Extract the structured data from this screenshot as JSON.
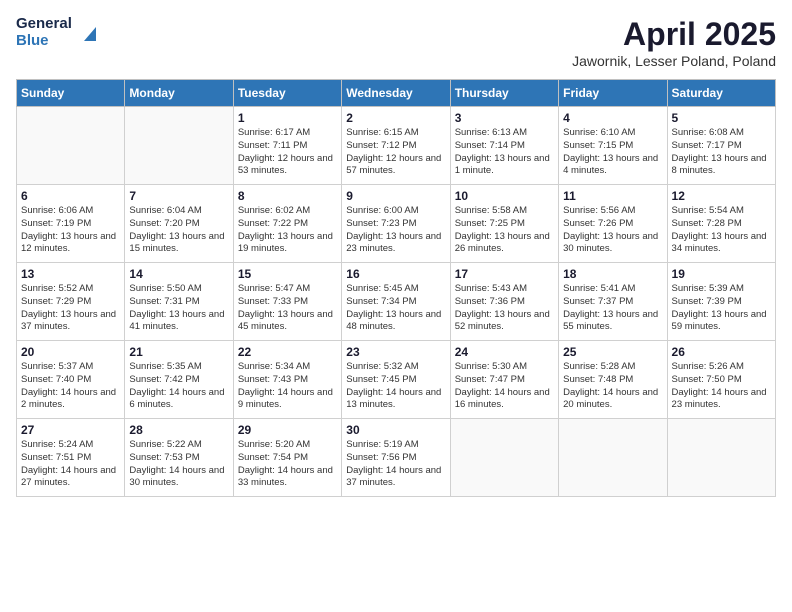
{
  "header": {
    "logo_general": "General",
    "logo_blue": "Blue",
    "month_title": "April 2025",
    "location": "Jawornik, Lesser Poland, Poland"
  },
  "weekdays": [
    "Sunday",
    "Monday",
    "Tuesday",
    "Wednesday",
    "Thursday",
    "Friday",
    "Saturday"
  ],
  "days": [
    {
      "num": "",
      "sunrise": "",
      "sunset": "",
      "daylight": ""
    },
    {
      "num": "",
      "sunrise": "",
      "sunset": "",
      "daylight": ""
    },
    {
      "num": "1",
      "sunrise": "Sunrise: 6:17 AM",
      "sunset": "Sunset: 7:11 PM",
      "daylight": "Daylight: 12 hours and 53 minutes."
    },
    {
      "num": "2",
      "sunrise": "Sunrise: 6:15 AM",
      "sunset": "Sunset: 7:12 PM",
      "daylight": "Daylight: 12 hours and 57 minutes."
    },
    {
      "num": "3",
      "sunrise": "Sunrise: 6:13 AM",
      "sunset": "Sunset: 7:14 PM",
      "daylight": "Daylight: 13 hours and 1 minute."
    },
    {
      "num": "4",
      "sunrise": "Sunrise: 6:10 AM",
      "sunset": "Sunset: 7:15 PM",
      "daylight": "Daylight: 13 hours and 4 minutes."
    },
    {
      "num": "5",
      "sunrise": "Sunrise: 6:08 AM",
      "sunset": "Sunset: 7:17 PM",
      "daylight": "Daylight: 13 hours and 8 minutes."
    },
    {
      "num": "6",
      "sunrise": "Sunrise: 6:06 AM",
      "sunset": "Sunset: 7:19 PM",
      "daylight": "Daylight: 13 hours and 12 minutes."
    },
    {
      "num": "7",
      "sunrise": "Sunrise: 6:04 AM",
      "sunset": "Sunset: 7:20 PM",
      "daylight": "Daylight: 13 hours and 15 minutes."
    },
    {
      "num": "8",
      "sunrise": "Sunrise: 6:02 AM",
      "sunset": "Sunset: 7:22 PM",
      "daylight": "Daylight: 13 hours and 19 minutes."
    },
    {
      "num": "9",
      "sunrise": "Sunrise: 6:00 AM",
      "sunset": "Sunset: 7:23 PM",
      "daylight": "Daylight: 13 hours and 23 minutes."
    },
    {
      "num": "10",
      "sunrise": "Sunrise: 5:58 AM",
      "sunset": "Sunset: 7:25 PM",
      "daylight": "Daylight: 13 hours and 26 minutes."
    },
    {
      "num": "11",
      "sunrise": "Sunrise: 5:56 AM",
      "sunset": "Sunset: 7:26 PM",
      "daylight": "Daylight: 13 hours and 30 minutes."
    },
    {
      "num": "12",
      "sunrise": "Sunrise: 5:54 AM",
      "sunset": "Sunset: 7:28 PM",
      "daylight": "Daylight: 13 hours and 34 minutes."
    },
    {
      "num": "13",
      "sunrise": "Sunrise: 5:52 AM",
      "sunset": "Sunset: 7:29 PM",
      "daylight": "Daylight: 13 hours and 37 minutes."
    },
    {
      "num": "14",
      "sunrise": "Sunrise: 5:50 AM",
      "sunset": "Sunset: 7:31 PM",
      "daylight": "Daylight: 13 hours and 41 minutes."
    },
    {
      "num": "15",
      "sunrise": "Sunrise: 5:47 AM",
      "sunset": "Sunset: 7:33 PM",
      "daylight": "Daylight: 13 hours and 45 minutes."
    },
    {
      "num": "16",
      "sunrise": "Sunrise: 5:45 AM",
      "sunset": "Sunset: 7:34 PM",
      "daylight": "Daylight: 13 hours and 48 minutes."
    },
    {
      "num": "17",
      "sunrise": "Sunrise: 5:43 AM",
      "sunset": "Sunset: 7:36 PM",
      "daylight": "Daylight: 13 hours and 52 minutes."
    },
    {
      "num": "18",
      "sunrise": "Sunrise: 5:41 AM",
      "sunset": "Sunset: 7:37 PM",
      "daylight": "Daylight: 13 hours and 55 minutes."
    },
    {
      "num": "19",
      "sunrise": "Sunrise: 5:39 AM",
      "sunset": "Sunset: 7:39 PM",
      "daylight": "Daylight: 13 hours and 59 minutes."
    },
    {
      "num": "20",
      "sunrise": "Sunrise: 5:37 AM",
      "sunset": "Sunset: 7:40 PM",
      "daylight": "Daylight: 14 hours and 2 minutes."
    },
    {
      "num": "21",
      "sunrise": "Sunrise: 5:35 AM",
      "sunset": "Sunset: 7:42 PM",
      "daylight": "Daylight: 14 hours and 6 minutes."
    },
    {
      "num": "22",
      "sunrise": "Sunrise: 5:34 AM",
      "sunset": "Sunset: 7:43 PM",
      "daylight": "Daylight: 14 hours and 9 minutes."
    },
    {
      "num": "23",
      "sunrise": "Sunrise: 5:32 AM",
      "sunset": "Sunset: 7:45 PM",
      "daylight": "Daylight: 14 hours and 13 minutes."
    },
    {
      "num": "24",
      "sunrise": "Sunrise: 5:30 AM",
      "sunset": "Sunset: 7:47 PM",
      "daylight": "Daylight: 14 hours and 16 minutes."
    },
    {
      "num": "25",
      "sunrise": "Sunrise: 5:28 AM",
      "sunset": "Sunset: 7:48 PM",
      "daylight": "Daylight: 14 hours and 20 minutes."
    },
    {
      "num": "26",
      "sunrise": "Sunrise: 5:26 AM",
      "sunset": "Sunset: 7:50 PM",
      "daylight": "Daylight: 14 hours and 23 minutes."
    },
    {
      "num": "27",
      "sunrise": "Sunrise: 5:24 AM",
      "sunset": "Sunset: 7:51 PM",
      "daylight": "Daylight: 14 hours and 27 minutes."
    },
    {
      "num": "28",
      "sunrise": "Sunrise: 5:22 AM",
      "sunset": "Sunset: 7:53 PM",
      "daylight": "Daylight: 14 hours and 30 minutes."
    },
    {
      "num": "29",
      "sunrise": "Sunrise: 5:20 AM",
      "sunset": "Sunset: 7:54 PM",
      "daylight": "Daylight: 14 hours and 33 minutes."
    },
    {
      "num": "30",
      "sunrise": "Sunrise: 5:19 AM",
      "sunset": "Sunset: 7:56 PM",
      "daylight": "Daylight: 14 hours and 37 minutes."
    },
    {
      "num": "",
      "sunrise": "",
      "sunset": "",
      "daylight": ""
    },
    {
      "num": "",
      "sunrise": "",
      "sunset": "",
      "daylight": ""
    },
    {
      "num": "",
      "sunrise": "",
      "sunset": "",
      "daylight": ""
    },
    {
      "num": "",
      "sunrise": "",
      "sunset": "",
      "daylight": ""
    }
  ]
}
